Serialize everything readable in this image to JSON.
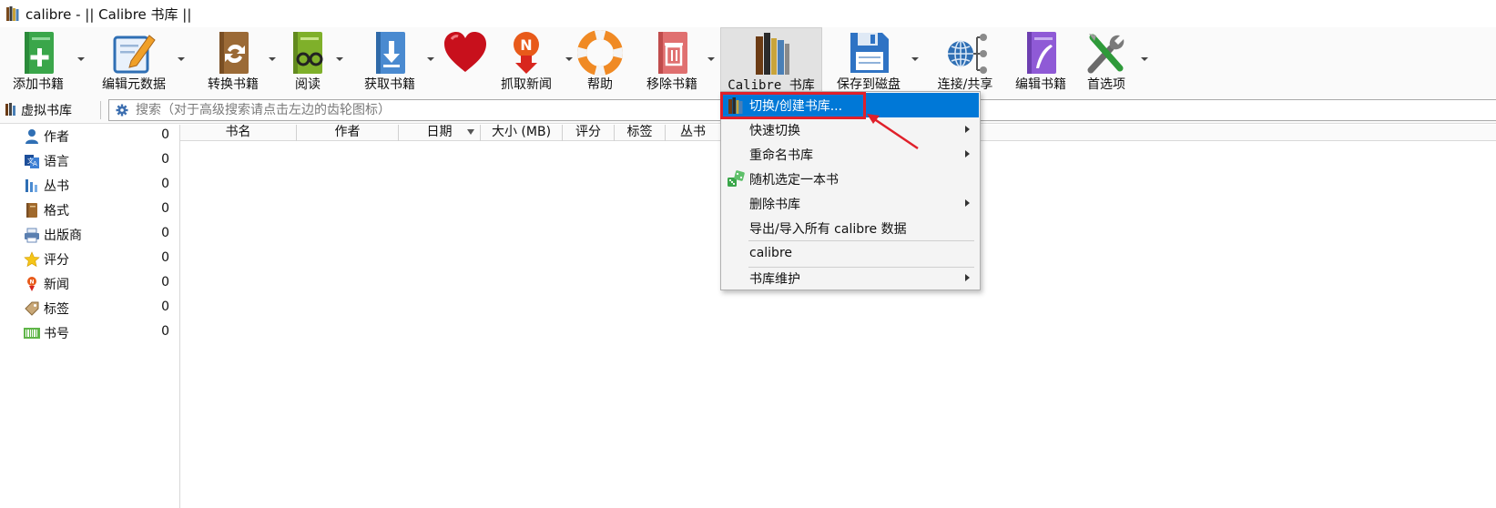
{
  "window": {
    "title": "calibre - || Calibre 书库 ||"
  },
  "toolbar": {
    "buttons": [
      {
        "label": "添加书籍",
        "icon": "add-book-icon"
      },
      {
        "label": "编辑元数据",
        "icon": "edit-metadata-icon"
      },
      {
        "label": "转换书籍",
        "icon": "convert-book-icon"
      },
      {
        "label": "阅读",
        "icon": "read-book-icon"
      },
      {
        "label": "获取书籍",
        "icon": "get-books-icon"
      },
      {
        "label": "",
        "icon": "donate-heart-icon"
      },
      {
        "label": "抓取新闻",
        "icon": "fetch-news-icon"
      },
      {
        "label": "帮助",
        "icon": "help-lifebuoy-icon"
      },
      {
        "label": "移除书籍",
        "icon": "remove-book-icon"
      },
      {
        "label": "Calibre 书库",
        "icon": "library-books-icon"
      },
      {
        "label": "保存到磁盘",
        "icon": "save-disk-icon"
      },
      {
        "label": "连接/共享",
        "icon": "connect-share-icon"
      },
      {
        "label": "编辑书籍",
        "icon": "edit-book-icon"
      },
      {
        "label": "首选项",
        "icon": "preferences-tools-icon"
      }
    ]
  },
  "searchbar": {
    "virtual_library": "虚拟书库",
    "search_placeholder": "搜索（对于高级搜索请点击左边的齿轮图标）"
  },
  "sidebar": {
    "items": [
      {
        "label": "作者",
        "count": "0",
        "icon": "authors-icon"
      },
      {
        "label": "语言",
        "count": "0",
        "icon": "languages-icon"
      },
      {
        "label": "丛书",
        "count": "0",
        "icon": "series-icon"
      },
      {
        "label": "格式",
        "count": "0",
        "icon": "formats-icon"
      },
      {
        "label": "出版商",
        "count": "0",
        "icon": "publisher-icon"
      },
      {
        "label": "评分",
        "count": "0",
        "icon": "rating-star-icon"
      },
      {
        "label": "新闻",
        "count": "0",
        "icon": "news-icon"
      },
      {
        "label": "标签",
        "count": "0",
        "icon": "tags-icon"
      },
      {
        "label": "书号",
        "count": "0",
        "icon": "isbn-barcode-icon"
      }
    ]
  },
  "table": {
    "columns": [
      "书名",
      "作者",
      "日期",
      "大小 (MB)",
      "评分",
      "标签",
      "丛书"
    ]
  },
  "library_menu": {
    "items": [
      {
        "label": "切换/创建书库...",
        "icon": "library-books-icon",
        "highlighted": true,
        "submenu": false
      },
      {
        "label": "快速切换",
        "submenu": true
      },
      {
        "label": "重命名书库",
        "submenu": true
      },
      {
        "label": "随机选定一本书",
        "icon": "random-dice-icon",
        "submenu": false
      },
      {
        "label": "删除书库",
        "submenu": true
      },
      {
        "label": "导出/导入所有 calibre 数据",
        "submenu": false
      },
      {
        "label": "calibre",
        "submenu": false
      },
      {
        "label": "书库维护",
        "submenu": true
      }
    ]
  },
  "colors": {
    "menu_highlight": "#0078d7",
    "annotation": "#e0202a"
  }
}
